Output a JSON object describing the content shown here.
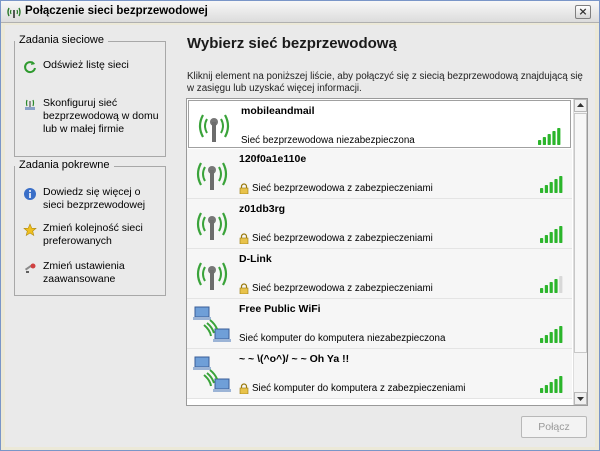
{
  "window": {
    "title": "Połączenie sieci bezprzewodowej",
    "close": "×"
  },
  "sidebar": {
    "network_tasks": {
      "title": "Zadania sieciowe",
      "items": [
        {
          "label": "Odśwież listę sieci",
          "icon": "refresh-icon"
        },
        {
          "label": "Skonfiguruj sieć bezprzewodową w domu lub w małej firmie",
          "icon": "setup-network-icon"
        }
      ]
    },
    "related_tasks": {
      "title": "Zadania pokrewne",
      "items": [
        {
          "label": "Dowiedz się więcej o sieci bezprzewodowej",
          "icon": "info-icon"
        },
        {
          "label": "Zmień kolejność sieci preferowanych",
          "icon": "star-icon"
        },
        {
          "label": "Zmień ustawienia zaawansowane",
          "icon": "settings-icon"
        }
      ]
    }
  },
  "main": {
    "title": "Wybierz sieć bezprzewodową",
    "description": "Kliknij element na poniższej liście, aby połączyć się z siecią bezprzewodową znajdującą się w zasięgu lub uzyskać więcej informacji.",
    "networks": [
      {
        "name": "mobileandmail",
        "status": "Sieć bezprzewodowa niezabezpieczona",
        "secured": false,
        "type": "access-point",
        "signal_bars": 5
      },
      {
        "name": "120f0a1e110e",
        "status": "Sieć bezprzewodowa z zabezpieczeniami",
        "secured": true,
        "type": "access-point",
        "signal_bars": 5
      },
      {
        "name": "z01db3rg",
        "status": "Sieć bezprzewodowa z zabezpieczeniami",
        "secured": true,
        "type": "access-point",
        "signal_bars": 5
      },
      {
        "name": "D-Link",
        "status": "Sieć bezprzewodowa z zabezpieczeniami",
        "secured": true,
        "type": "access-point",
        "signal_bars": 4
      },
      {
        "name": "Free Public WiFi",
        "status": "Sieć komputer do komputera niezabezpieczona",
        "secured": false,
        "type": "ad-hoc",
        "signal_bars": 5
      },
      {
        "name": "~ ~ \\(^o^)/ ~ ~ Oh Ya !!",
        "status": "Sieć komputer do komputera z zabezpieczeniami",
        "secured": true,
        "type": "ad-hoc",
        "signal_bars": 5
      }
    ],
    "connect_label": "Połącz"
  },
  "colors": {
    "signal_on": "#2bb52b",
    "signal_off": "#d8d8d8",
    "title_bar": "#e4e4e4"
  }
}
